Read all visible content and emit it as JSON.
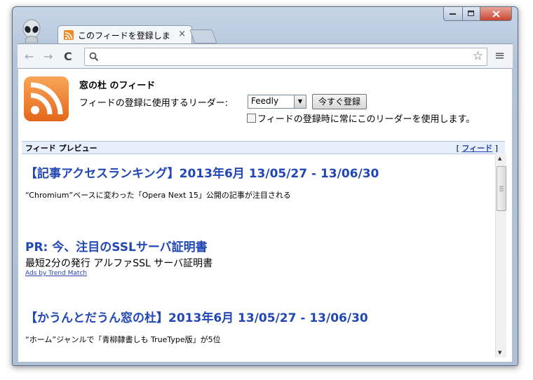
{
  "browser": {
    "tab_title": "このフィードを登録しま",
    "tab_close": "×",
    "nav": {
      "back": "←",
      "forward": "→",
      "reload": "C"
    },
    "omnibox_value": "",
    "star": "☆",
    "menu": "≡"
  },
  "subscribe": {
    "feed_title": "窓の杜 のフィード",
    "reader_label": "フィードの登録に使用するリーダー:",
    "reader_selected": "Feedly",
    "subscribe_button": "今すぐ登録",
    "always_use_label": "フィードの登録時に常にこのリーダーを使用します。"
  },
  "preview": {
    "bar_title": "フィード プレビュー",
    "feed_link_label": "フィード",
    "entries": [
      {
        "title": "【記事アクセスランキング】2013年6月 13/05/27 - 13/06/30",
        "description": "“Chromium”ベースに変わった「Opera Next 15」公開の記事が注目される"
      },
      {
        "title": "PR: 今、注目のSSLサーバ証明書",
        "description": "最短2分の発行 アルファSSL サーバ証明書",
        "ad_link": "Ads by Trend Match"
      },
      {
        "title": "【かうんとだうん窓の杜】2013年6月 13/05/27 - 13/06/30",
        "description": "“ホーム”ジャンルで「青柳隷書しも TrueType版」が5位"
      }
    ]
  },
  "colors": {
    "accent_link": "#2147b4",
    "rss_orange": "#f08a24",
    "preview_bar": "#e6eefb"
  },
  "icons": [
    "alien-logo-icon",
    "rss-icon",
    "search-icon",
    "star-icon",
    "menu-icon",
    "close-icon",
    "minimize-icon",
    "maximize-icon"
  ]
}
